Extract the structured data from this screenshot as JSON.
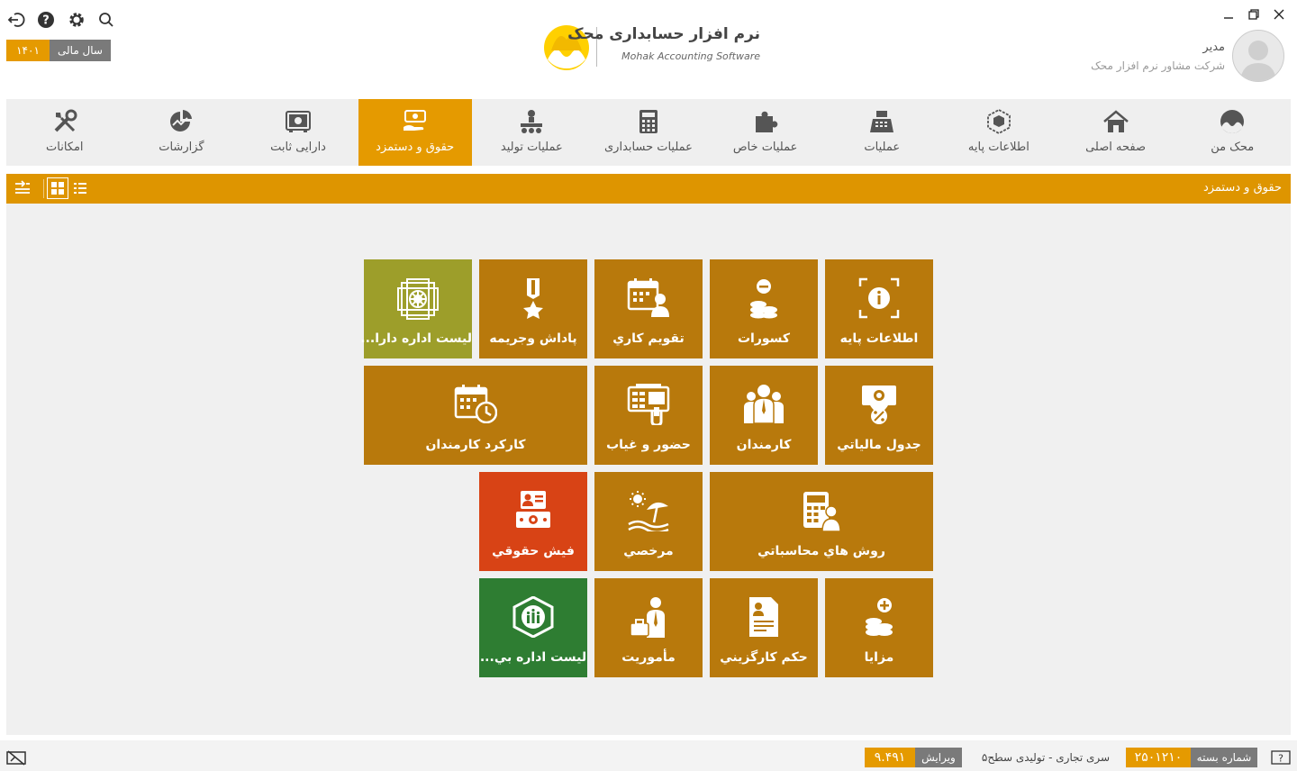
{
  "topbar": {
    "icons": [
      "logout-icon",
      "help-icon",
      "gear-icon",
      "search-icon"
    ],
    "fiscal_year_label": "سال مالی",
    "fiscal_year_value": "۱۴۰۱"
  },
  "logo": {
    "title_fa": "نرم افزار حسابداری محک",
    "title_en": "Mohak Accounting Software"
  },
  "user": {
    "name": "مدیر",
    "company": "شرکت مشاور نرم افزار محک"
  },
  "nav": {
    "items": [
      {
        "label": "محک من",
        "icon": "mohak-icon"
      },
      {
        "label": "صفحه اصلی",
        "icon": "home-icon"
      },
      {
        "label": "اطلاعات پایه",
        "icon": "cube-icon"
      },
      {
        "label": "عملیات",
        "icon": "cash-register-icon"
      },
      {
        "label": "عملیات خاص",
        "icon": "puzzle-icon"
      },
      {
        "label": "عملیات حسابداری",
        "icon": "calculator-icon"
      },
      {
        "label": "عملیات تولید",
        "icon": "production-icon"
      },
      {
        "label": "حقوق و دستمزد",
        "icon": "salary-icon",
        "active": true
      },
      {
        "label": "دارایی ثابت",
        "icon": "safe-icon"
      },
      {
        "label": "گزارشات",
        "icon": "report-chart-icon"
      },
      {
        "label": "امکانات",
        "icon": "tools-icon"
      }
    ]
  },
  "section": {
    "title": "حقوق و دستمزد"
  },
  "tiles": [
    {
      "label": "اطلاعات پایه",
      "icon": "info-icon"
    },
    {
      "label": "کسورات",
      "icon": "coins-minus-icon"
    },
    {
      "label": "تقويم كاري",
      "icon": "calendar-person-icon"
    },
    {
      "label": "پاداش وجريمه",
      "icon": "medal-icon"
    },
    {
      "label": "ليست اداره دارا...",
      "icon": "tax-office-icon"
    },
    {
      "label": "جدول مالياتي",
      "icon": "tax-table-icon"
    },
    {
      "label": "کارمندان",
      "icon": "employees-icon"
    },
    {
      "label": "حضور و غياب",
      "icon": "attendance-icon"
    },
    {
      "label": "کارکرد کارمندان",
      "icon": "calendar-clock-icon"
    },
    {
      "label": "روش هاي محاسباتي",
      "icon": "calculator-person-icon"
    },
    {
      "label": "مرخصي",
      "icon": "beach-icon"
    },
    {
      "label": "فيش حقوقي",
      "icon": "payslip-icon"
    },
    {
      "label": "مزايا",
      "icon": "coins-plus-icon"
    },
    {
      "label": "حکم کارگزيني",
      "icon": "decree-icon"
    },
    {
      "label": "مأموريت",
      "icon": "mission-icon"
    },
    {
      "label": "ليست اداره بي...",
      "icon": "insurance-icon"
    }
  ],
  "status": {
    "package_label": "شماره بسته",
    "package_value": "۲۵۰۱۲۱۰",
    "series": "سری تجاری - تولیدی سطح۵",
    "version_label": "ویرایش",
    "version_value": "۹.۴۹۱"
  },
  "colors": {
    "accent": "#e59a00",
    "tile": "#b8790c",
    "tile_olive": "#9d9e2a",
    "tile_red": "#d84315",
    "tile_green": "#2e7d32"
  }
}
